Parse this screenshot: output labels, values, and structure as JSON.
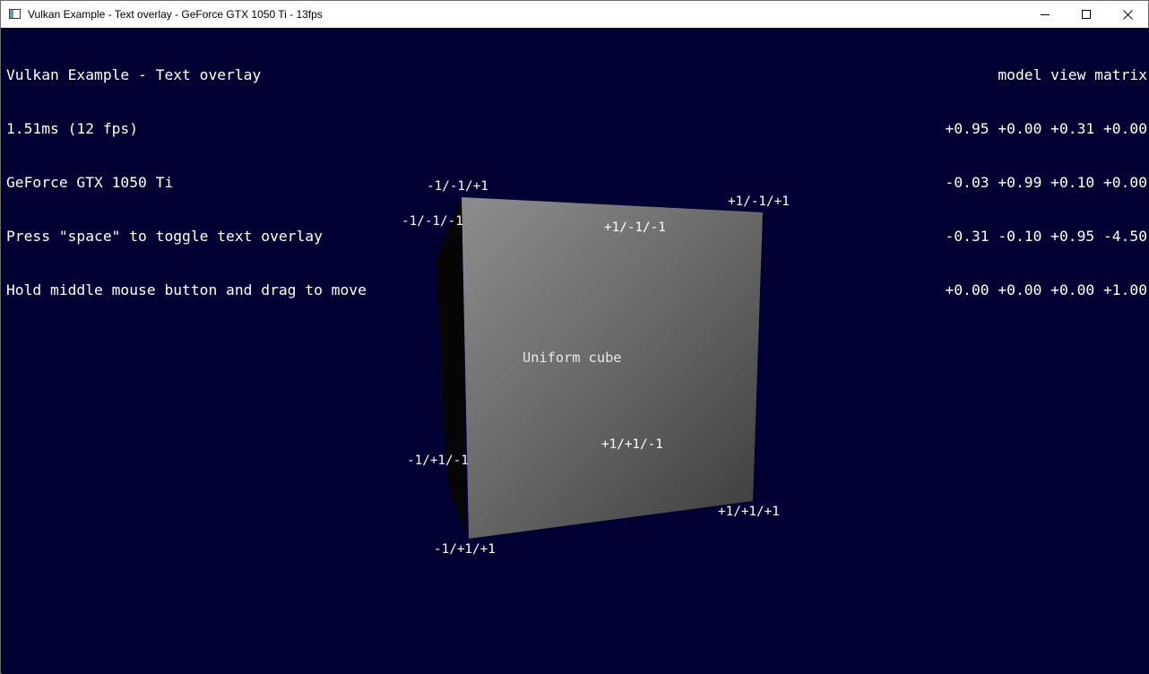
{
  "window": {
    "title": "Vulkan Example - Text overlay - GeForce GTX 1050 Ti - 13fps",
    "app_icon": "app-window-icon",
    "controls": {
      "minimize_icon": "minimize-icon",
      "maximize_icon": "maximize-icon",
      "close_icon": "close-icon"
    }
  },
  "overlay": {
    "lines": [
      "Vulkan Example - Text overlay",
      "1.51ms (12 fps)",
      "GeForce GTX 1050 Ti",
      "Press \"space\" to toggle text overlay",
      "Hold middle mouse button and drag to move"
    ]
  },
  "matrix": {
    "title": "model view matrix",
    "rows": [
      "+0.95 +0.00 +0.31 +0.00",
      "-0.03 +0.99 +0.10 +0.00",
      "-0.31 -0.10 +0.95 -4.50",
      "+0.00 +0.00 +0.00 +1.00"
    ]
  },
  "cube": {
    "center_label": "Uniform cube",
    "vertex_labels": {
      "v1": "-1/-1/+1",
      "v2": "-1/-1/-1",
      "v3": "+1/-1/+1",
      "v4": "+1/-1/-1",
      "v5": "+1/+1/-1",
      "v6": "-1/+1/-1",
      "v7": "+1/+1/+1",
      "v8": "-1/+1/+1"
    },
    "colors": {
      "background": "#000033",
      "face_light": "#8a8a8a",
      "face_dark": "#3f3f3f",
      "side_face": "#050505"
    }
  }
}
